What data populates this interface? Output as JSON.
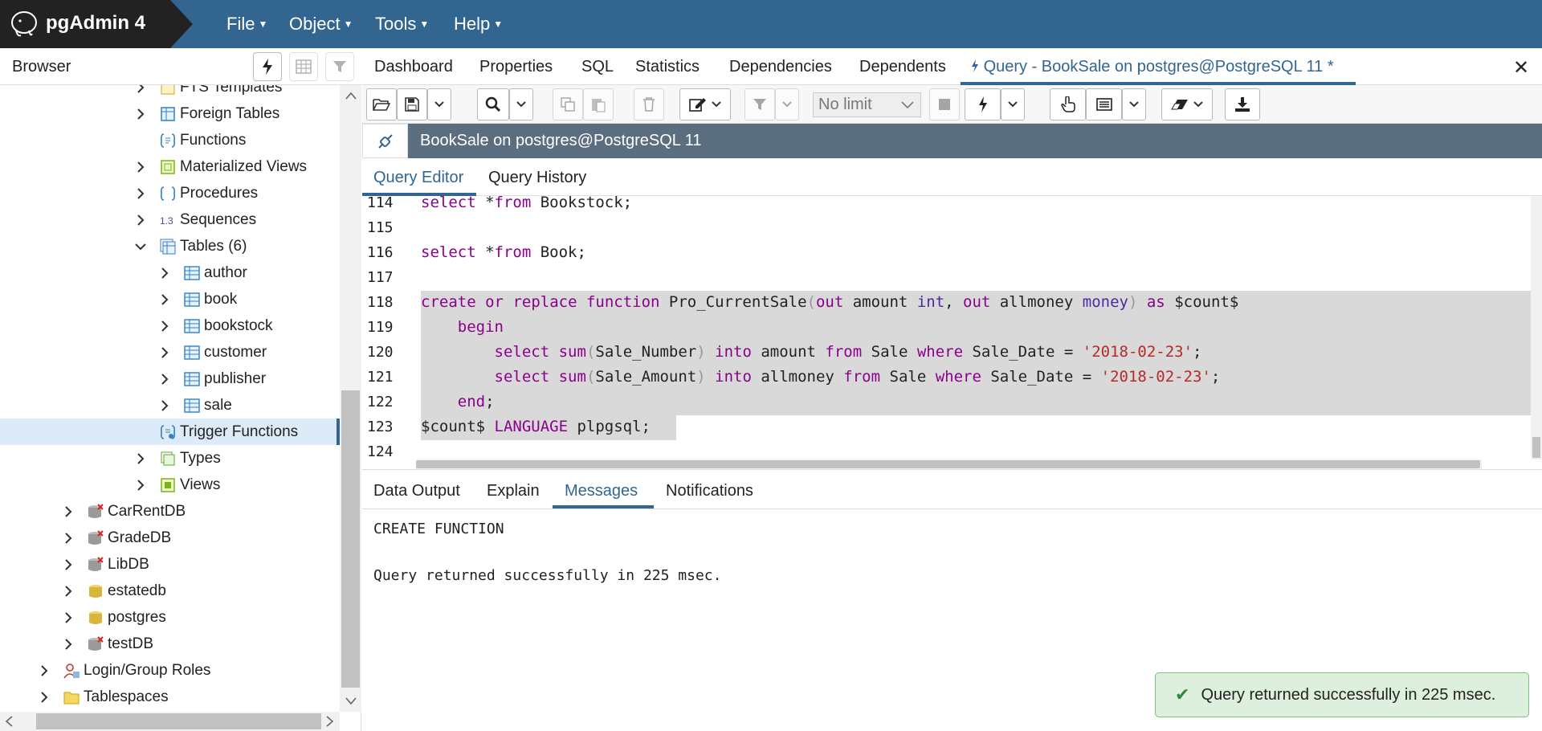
{
  "app": {
    "brand": "pgAdmin 4"
  },
  "menu": [
    {
      "label": "File"
    },
    {
      "label": "Object"
    },
    {
      "label": "Tools"
    },
    {
      "label": "Help"
    }
  ],
  "browser": {
    "title": "Browser",
    "tree": [
      {
        "label": "FTS Templates",
        "icon": "fts-templates-icon"
      },
      {
        "label": "Foreign Tables",
        "icon": "foreign-table-icon"
      },
      {
        "label": "Functions",
        "icon": "function-icon"
      },
      {
        "label": "Materialized Views",
        "icon": "materialized-view-icon"
      },
      {
        "label": "Procedures",
        "icon": "procedure-icon"
      },
      {
        "label": "Sequences",
        "icon": "sequence-icon"
      },
      {
        "label": "Tables (6)",
        "icon": "tables-icon"
      },
      {
        "label": "author",
        "icon": "table-icon"
      },
      {
        "label": "book",
        "icon": "table-icon"
      },
      {
        "label": "bookstock",
        "icon": "table-icon"
      },
      {
        "label": "customer",
        "icon": "table-icon"
      },
      {
        "label": "publisher",
        "icon": "table-icon"
      },
      {
        "label": "sale",
        "icon": "table-icon"
      },
      {
        "label": "Trigger Functions",
        "icon": "trigger-function-icon"
      },
      {
        "label": "Types",
        "icon": "type-icon"
      },
      {
        "label": "Views",
        "icon": "view-icon"
      },
      {
        "label": "CarRentDB",
        "icon": "database-disconnected-icon"
      },
      {
        "label": "GradeDB",
        "icon": "database-disconnected-icon"
      },
      {
        "label": "LibDB",
        "icon": "database-disconnected-icon"
      },
      {
        "label": "estatedb",
        "icon": "database-icon"
      },
      {
        "label": "postgres",
        "icon": "database-icon"
      },
      {
        "label": "testDB",
        "icon": "database-disconnected-icon"
      },
      {
        "label": "Login/Group Roles",
        "icon": "roles-icon"
      },
      {
        "label": "Tablespaces",
        "icon": "tablespaces-icon"
      }
    ]
  },
  "tabs": [
    {
      "label": "Dashboard"
    },
    {
      "label": "Properties"
    },
    {
      "label": "SQL"
    },
    {
      "label": "Statistics"
    },
    {
      "label": "Dependencies"
    },
    {
      "label": "Dependents"
    },
    {
      "label": "Query - BookSale on postgres@PostgreSQL 11 *"
    }
  ],
  "toolbar": {
    "limit_select": "No limit"
  },
  "connection": {
    "label": "BookSale on postgres@PostgreSQL 11"
  },
  "subtabs": [
    {
      "label": "Query Editor"
    },
    {
      "label": "Query History"
    }
  ],
  "editor": {
    "lines": [
      {
        "num": "114",
        "text": "select *from Bookstock;"
      },
      {
        "num": "115",
        "text": ""
      },
      {
        "num": "116",
        "text": "select *from Book;"
      },
      {
        "num": "117",
        "text": ""
      },
      {
        "num": "118",
        "text": "create or replace function Pro_CurrentSale(out amount int, out allmoney money) as $count$"
      },
      {
        "num": "119",
        "text": "    begin"
      },
      {
        "num": "120",
        "text": "        select sum(Sale_Number) into amount from Sale where Sale_Date = '2018-02-23';"
      },
      {
        "num": "121",
        "text": "        select sum(Sale_Amount) into allmoney from Sale where Sale_Date = '2018-02-23';"
      },
      {
        "num": "122",
        "text": "    end;"
      },
      {
        "num": "123",
        "text": "$count$ LANGUAGE plpgsql;"
      },
      {
        "num": "124",
        "text": ""
      }
    ]
  },
  "output_tabs": [
    {
      "label": "Data Output"
    },
    {
      "label": "Explain"
    },
    {
      "label": "Messages"
    },
    {
      "label": "Notifications"
    }
  ],
  "messages": [
    "CREATE FUNCTION",
    "Query returned successfully in 225 msec."
  ],
  "toast": {
    "text": "Query returned successfully in 225 msec."
  },
  "colors": {
    "navbar": "#326690",
    "brand_bg": "#222222",
    "accent": "#326690",
    "connection_bar": "#5b6e80",
    "toast_bg": "#ddf0de"
  }
}
